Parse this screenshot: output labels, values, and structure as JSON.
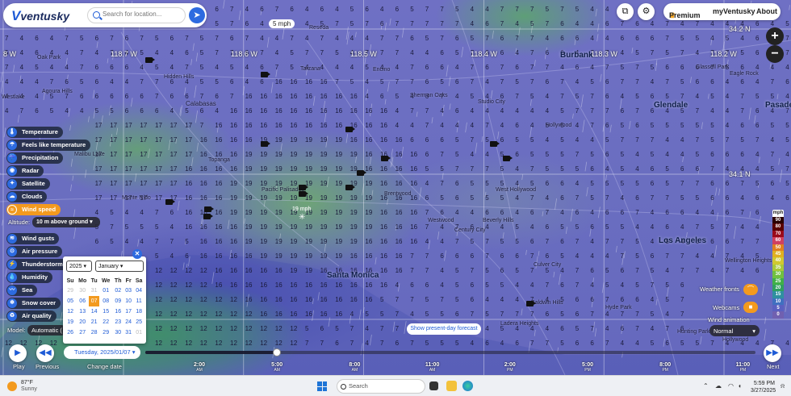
{
  "app": {
    "logo": "ventusky",
    "search_placeholder": "Search for location...",
    "top_speed_label": "5 mph",
    "menu": {
      "premium": "Premium",
      "my": "myVentusky",
      "about": "About"
    }
  },
  "map": {
    "coords": {
      "lon_8w": "8 W",
      "lon_1187": "118.7 W",
      "lon_1186": "118.6 W",
      "lon_1185": "118.5 W",
      "lon_1184": "118.4 W",
      "lon_1183": "118.3 W",
      "lon_1182": "118.2 W",
      "lat_342": "34.2 N",
      "lat_341": "34.1 N"
    },
    "cities": {
      "burbank": "Burbank",
      "glendale": "Glendale",
      "la": "Los Angeles",
      "santa_monica": "Santa Monica",
      "pasadena": "Pasade",
      "calabasas": "Calabasas"
    },
    "places": [
      "Oak Park",
      "Agoura Hills",
      "Hidden Hills",
      "Encino",
      "Tarzana",
      "Reseda",
      "Sherman Oaks",
      "Studio City",
      "Hollywood",
      "West Hollywood",
      "Beverly Hills",
      "Century City",
      "Culver City",
      "Topanga",
      "Malibu Lake",
      "Monte Nido",
      "Baldwin Hills",
      "Inglewood",
      "Hunting Park",
      "Westlake",
      "Pacific Palisades",
      "Brentwood",
      "Westwood",
      "Glassell Park",
      "Eagle Rock",
      "Hyde Park",
      "Ladera Heights",
      "Leimert Park",
      "Wellington Heights",
      "Hollywood"
    ],
    "wind_label": "19 mph"
  },
  "layers": {
    "items": [
      {
        "label": "Temperature",
        "icon": "thermometer-icon",
        "glyph": "🌡"
      },
      {
        "label": "Feels like temperature",
        "icon": "feels-like-icon",
        "glyph": "☂"
      },
      {
        "label": "Precipitation",
        "icon": "precipitation-icon",
        "glyph": "☔"
      },
      {
        "label": "Radar",
        "icon": "radar-icon",
        "glyph": "◉"
      },
      {
        "label": "Satellite",
        "icon": "satellite-icon",
        "glyph": "✦"
      },
      {
        "label": "Clouds",
        "icon": "cloud-icon",
        "glyph": "☁"
      },
      {
        "label": "Wind speed",
        "icon": "wind-icon",
        "glyph": "≈",
        "active": true
      },
      {
        "label": "Wind gusts",
        "icon": "gust-icon",
        "glyph": "≋"
      },
      {
        "label": "Air pressure",
        "icon": "pressure-icon",
        "glyph": "⊙"
      },
      {
        "label": "Thunderstorms",
        "icon": "lightning-icon",
        "glyph": "⚡"
      },
      {
        "label": "Humidity",
        "icon": "humidity-icon",
        "glyph": "💧"
      },
      {
        "label": "Sea",
        "icon": "sea-icon",
        "glyph": "〰"
      },
      {
        "label": "Snow cover",
        "icon": "snow-icon",
        "glyph": "❄"
      },
      {
        "label": "Air quality",
        "icon": "air-quality-icon",
        "glyph": "♻"
      }
    ],
    "altitude_label": "Altitude:",
    "altitude_value": "10 m above ground",
    "model_label": "Model:",
    "model_value": "Automatic ("
  },
  "calendar": {
    "year": "2025",
    "month": "January",
    "weekdays": [
      "Su",
      "Mo",
      "Tu",
      "We",
      "Th",
      "Fr",
      "Sa"
    ],
    "weeks": [
      [
        "29",
        "30",
        "31",
        "01",
        "02",
        "03",
        "04"
      ],
      [
        "05",
        "06",
        "07",
        "08",
        "09",
        "10",
        "11"
      ],
      [
        "12",
        "13",
        "14",
        "15",
        "16",
        "17",
        "18"
      ],
      [
        "19",
        "20",
        "21",
        "22",
        "23",
        "24",
        "25"
      ],
      [
        "26",
        "27",
        "28",
        "29",
        "30",
        "31",
        "01"
      ]
    ],
    "selected": "07"
  },
  "timeline": {
    "play": "Play",
    "previous": "Previous",
    "next": "Next",
    "change_date": "Change date",
    "date": "Tuesday, 2025/01/07",
    "present_btn": "Show present-day forecast",
    "progress": 0.216,
    "ticks": [
      {
        "time": "2:00",
        "ampm": "AM"
      },
      {
        "time": "5:00",
        "ampm": "AM"
      },
      {
        "time": "8:00",
        "ampm": "AM"
      },
      {
        "time": "11:00",
        "ampm": "AM"
      },
      {
        "time": "2:00",
        "ampm": "PM"
      },
      {
        "time": "5:00",
        "ampm": "PM"
      },
      {
        "time": "8:00",
        "ampm": "PM"
      },
      {
        "time": "11:00",
        "ampm": "PM"
      }
    ]
  },
  "legend": {
    "unit": "mph",
    "steps": [
      {
        "v": "90",
        "c": "#2a0000"
      },
      {
        "v": "80",
        "c": "#5a0000"
      },
      {
        "v": "70",
        "c": "#9a0a1a"
      },
      {
        "v": "60",
        "c": "#d04060"
      },
      {
        "v": "50",
        "c": "#e08020"
      },
      {
        "v": "45",
        "c": "#e0b020"
      },
      {
        "v": "40",
        "c": "#d0c830"
      },
      {
        "v": "35",
        "c": "#a8c838"
      },
      {
        "v": "30",
        "c": "#70c040"
      },
      {
        "v": "25",
        "c": "#40b048"
      },
      {
        "v": "20",
        "c": "#30a060"
      },
      {
        "v": "15",
        "c": "#3090a0"
      },
      {
        "v": "10",
        "c": "#4070c0"
      },
      {
        "v": "5",
        "c": "#5a60c0"
      },
      {
        "v": "0",
        "c": "#7060b0"
      }
    ]
  },
  "overlays": {
    "fronts": "Weather fronts",
    "webcams": "Webcams",
    "animation": "Wind animation",
    "animation_value": "Normal"
  },
  "taskbar": {
    "temp": "87°F",
    "cond": "Sunny",
    "search": "Search",
    "time": "5:59 PM",
    "date": "3/27/2025"
  }
}
